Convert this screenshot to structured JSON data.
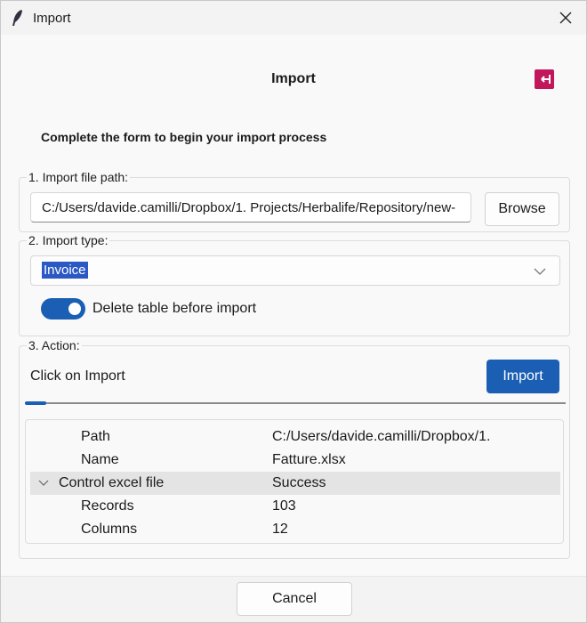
{
  "window": {
    "title": "Import"
  },
  "header": {
    "title": "Import"
  },
  "subtitle": "Complete the form to begin your import process",
  "section_file": {
    "legend": "1. Import file path:",
    "path_value": "C:/Users/davide.camilli/Dropbox/1. Projects/Herbalife/Repository/new-",
    "browse_label": "Browse"
  },
  "section_type": {
    "legend": "2. Import type:",
    "selected": "Invoice",
    "toggle_label": "Delete table before import",
    "toggle_on": true
  },
  "section_action": {
    "legend": "3. Action:",
    "status_label": "Click on Import",
    "import_label": "Import",
    "progress_fraction": 0.04
  },
  "tree": {
    "rows": [
      {
        "key": "Path",
        "value": "C:/Users/davide.camilli/Dropbox/1."
      },
      {
        "key": "Name",
        "value": "Fatture.xlsx"
      },
      {
        "key": "Control excel file",
        "value": "Success",
        "expanded": true,
        "selected": true
      },
      {
        "key": "Records",
        "value": "103"
      },
      {
        "key": "Columns",
        "value": "12"
      }
    ]
  },
  "footer": {
    "cancel_label": "Cancel"
  },
  "colors": {
    "accent": "#1a5fb4",
    "exit": "#c2185b",
    "selection": "#2b58c5"
  },
  "icons": {
    "app": "feather-icon",
    "close": "close-icon",
    "exit": "exit-icon",
    "dropdown": "chevron-down-icon",
    "expander": "chevron-down-icon"
  }
}
